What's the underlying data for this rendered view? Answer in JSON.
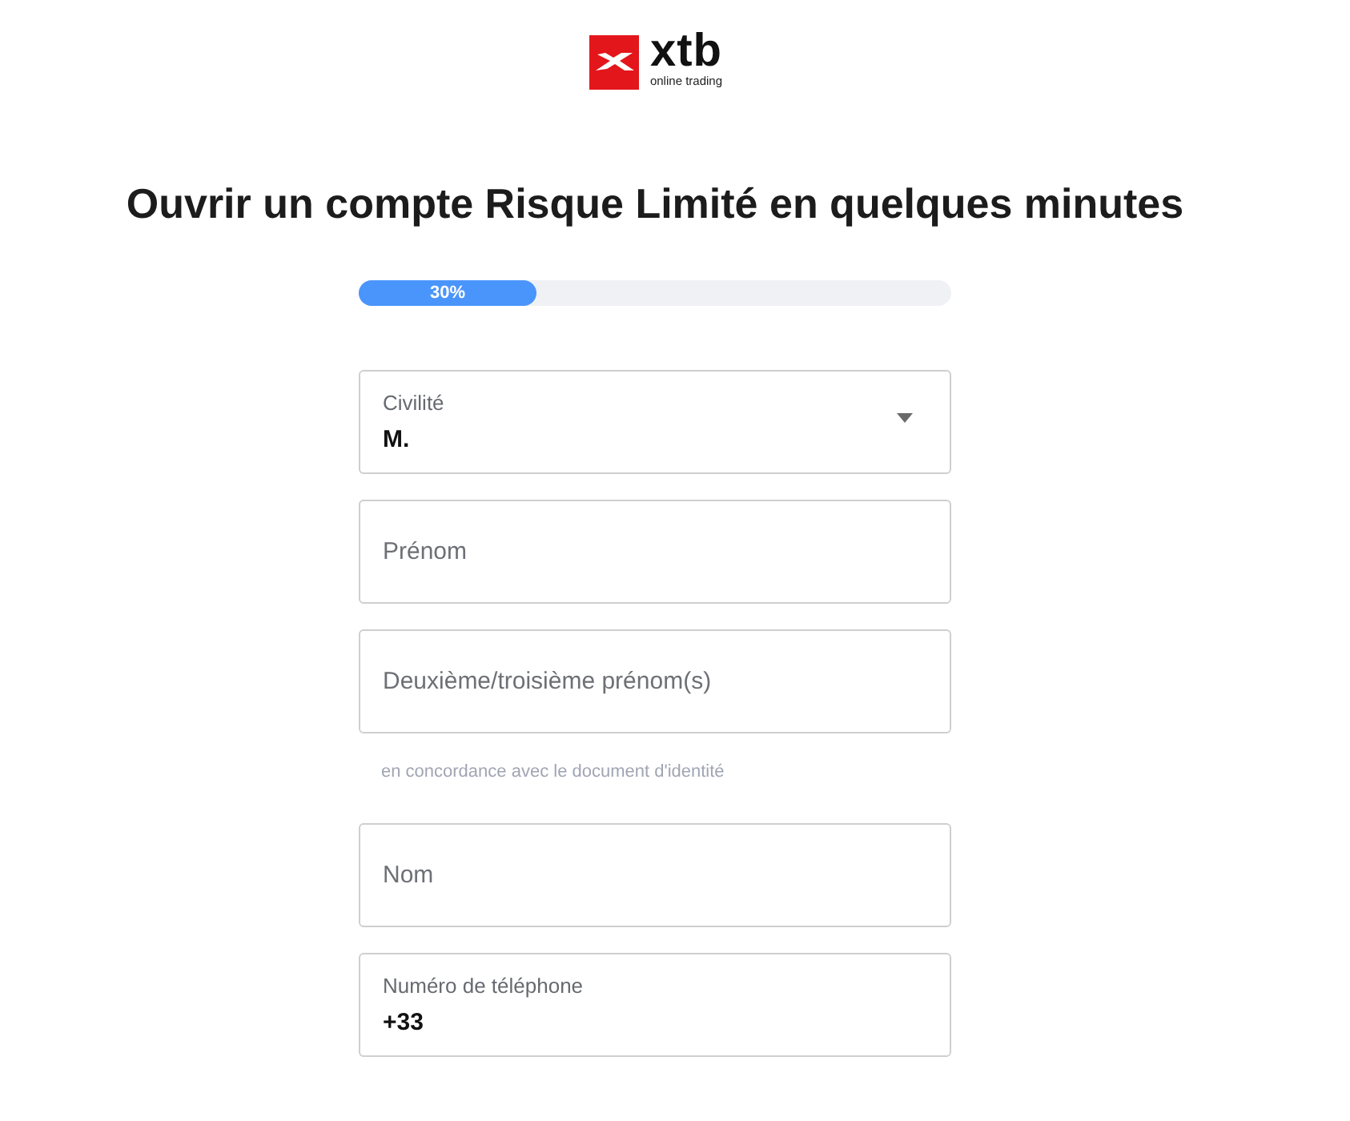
{
  "logo": {
    "wordmark": "xtb",
    "tagline": "online trading"
  },
  "title": "Ouvrir un compte Risque Limité en quelques minutes",
  "progress": {
    "level": 0.3,
    "reading": "30%"
  },
  "fields": [
    {
      "kind": "select",
      "label": "Civilité",
      "value": "M."
    },
    {
      "kind": "text",
      "placeholder": "Prénom"
    },
    {
      "kind": "text",
      "placeholder": "Deuxième/troisième prénom(s)",
      "hint": "en concordance avec le document d'identité"
    },
    {
      "kind": "text",
      "placeholder": "Nom"
    },
    {
      "kind": "text",
      "label": "Numéro de téléphone",
      "value": "+33"
    }
  ]
}
